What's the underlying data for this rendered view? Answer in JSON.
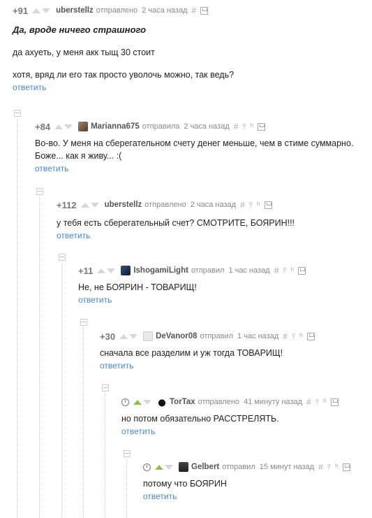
{
  "comments": [
    {
      "rating": "+91",
      "author": "uberstellz",
      "action": "отправлено",
      "time": "2 часа назад",
      "reply": "ответить",
      "text": [
        "Да, вроде ничего страшного",
        "да ахуеть, у меня акк тыщ 30 стоит",
        "хотя, вряд ли его так просто уволочь можно, так ведь?"
      ]
    },
    {
      "rating": "+84",
      "author": "Marianna675",
      "action": "отправила",
      "time": "2 часа назад",
      "reply": "ответить",
      "text": [
        "Во-во. У меня на сберегательном счету денег меньше, чем в стиме суммарно. Боже... как я живу... :("
      ]
    },
    {
      "rating": "+112",
      "author": "uberstellz",
      "action": "отправлено",
      "time": "2 часа назад",
      "reply": "ответить",
      "text": [
        "у тебя есть сберегательный счет? СМОТРИТЕ, БОЯРИН!!!"
      ]
    },
    {
      "rating": "+11",
      "author": "IshogamiLight",
      "action": "отправил",
      "time": "1 час назад",
      "reply": "ответить",
      "text": [
        "Не, не БОЯРИН - ТОВАРИЩ!"
      ]
    },
    {
      "rating": "+30",
      "author": "DeVanor08",
      "action": "отправил",
      "time": "1 час назад",
      "reply": "ответить",
      "text": [
        "сначала все разделим и уж тогда ТОВАРИЩ!"
      ]
    },
    {
      "rating": "",
      "author": "TorTax",
      "action": "отправлено",
      "time": "41 минуту назад",
      "reply": "ответить",
      "text": [
        "но потом обязательно РАССТРЕЛЯТЬ."
      ]
    },
    {
      "rating": "",
      "author": "Gelbert",
      "action": "отправил",
      "time": "15 минут назад",
      "reply": "ответить",
      "text": [
        "потому что БОЯРИН"
      ]
    }
  ],
  "tool_icons": {
    "link": "#",
    "up_tree": "⫯",
    "branch": "ʰ"
  },
  "colors": {
    "reply_link": "#4a86c5",
    "upvote_active": "#8bc34a"
  }
}
